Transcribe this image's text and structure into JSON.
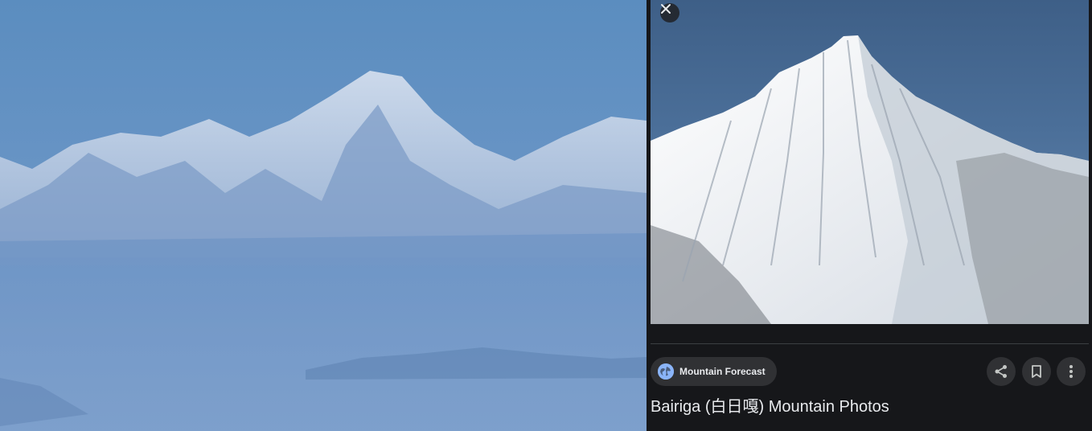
{
  "viewer": {
    "background_image": "blurred-mountain-range-icon",
    "accent_color": "#8ab4f8"
  },
  "panel": {
    "close_icon": "close-icon",
    "preview_image": "mountain-peak-icon",
    "source": {
      "icon": "globe-icon",
      "name": "Mountain Forecast"
    },
    "actions": [
      {
        "icon": "share-icon"
      },
      {
        "icon": "bookmark-icon"
      },
      {
        "icon": "more-vert-icon"
      }
    ],
    "title": "Bairiga (白日嘎) Mountain Photos"
  }
}
